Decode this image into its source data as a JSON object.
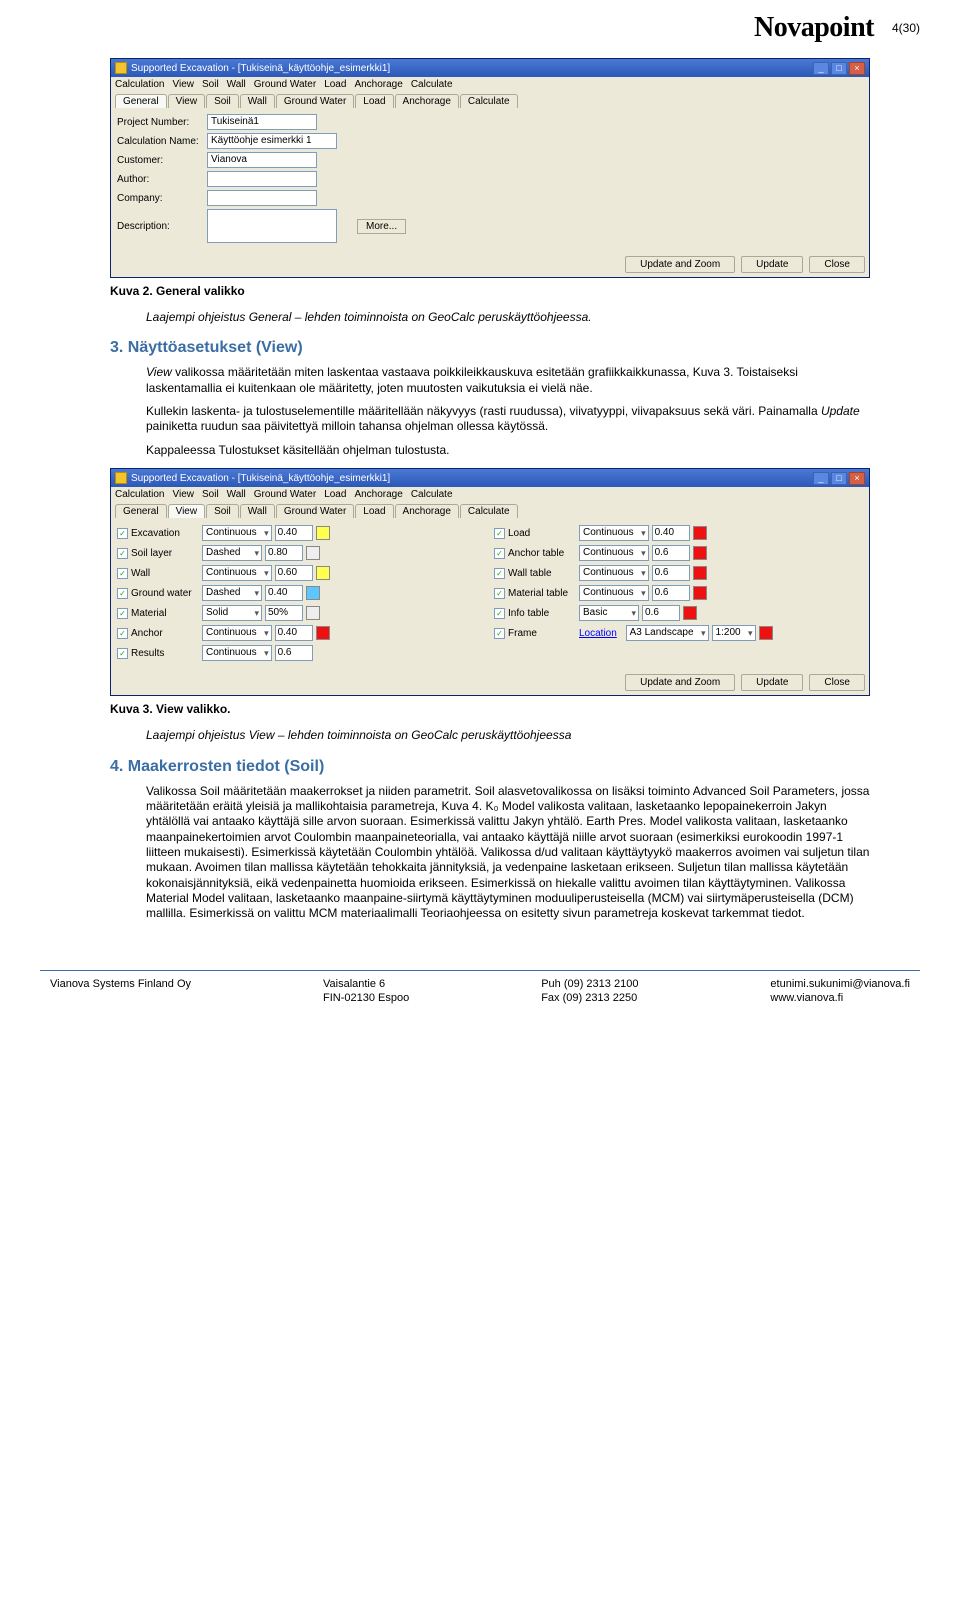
{
  "brand": "Novapoint",
  "page_number": "4(30)",
  "win1": {
    "title": "Supported Excavation - [Tukiseinä_käyttöohje_esimerkki1]",
    "menubar": [
      "Calculation",
      "View",
      "Soil",
      "Wall",
      "Ground Water",
      "Load",
      "Anchorage",
      "Calculate"
    ],
    "tabs": [
      "General",
      "View",
      "Soil",
      "Wall",
      "Ground Water",
      "Load",
      "Anchorage",
      "Calculate"
    ],
    "fields": {
      "project_label": "Project Number:",
      "project_value": "Tukiseinä1",
      "calc_label": "Calculation Name:",
      "calc_value": "Käyttöohje esimerkki 1",
      "customer_label": "Customer:",
      "customer_value": "Vianova",
      "author_label": "Author:",
      "company_label": "Company:",
      "description_label": "Description:",
      "more_btn": "More..."
    },
    "buttons": {
      "uz": "Update and Zoom",
      "u": "Update",
      "c": "Close"
    }
  },
  "caption1": "Kuva 2. General valikko",
  "intro_para": "Laajempi ohjeistus General – lehden toiminnoista on GeoCalc peruskäyttöohjeessa.",
  "section3": {
    "heading": "3. Näyttöasetukset (View)",
    "p1a": "View",
    "p1b": " valikossa määritetään miten laskentaa vastaava poikkileikkauskuva esitetään grafiikkaikkunassa, Kuva 3. Toistaiseksi laskentamallia ei kuitenkaan ole määritetty, joten muutosten vaikutuksia ei vielä näe.",
    "p2a": "Kullekin laskenta- ja tulostuselementille määritellään näkyvyys (rasti ruudussa), viivatyyppi, viivapaksuus sekä väri. Painamalla ",
    "p2b": "Update",
    "p2c": " painiketta ruudun saa päivitettyä milloin tahansa ohjelman ollessa käytössä.",
    "p3": "Kappaleessa Tulostukset käsitellään ohjelman tulostusta."
  },
  "win2": {
    "title": "Supported Excavation - [Tukiseinä_käyttöohje_esimerkki1]",
    "menubar": [
      "Calculation",
      "View",
      "Soil",
      "Wall",
      "Ground Water",
      "Load",
      "Anchorage",
      "Calculate"
    ],
    "tabs": [
      "General",
      "View",
      "Soil",
      "Wall",
      "Ground Water",
      "Load",
      "Anchorage",
      "Calculate"
    ],
    "col1": [
      {
        "name": "Excavation",
        "style": "Continuous",
        "w": "0.40",
        "c": "#ffff4d"
      },
      {
        "name": "Soil layer",
        "style": "Dashed",
        "w": "0.80",
        "c": "#ffffff"
      },
      {
        "name": "Wall",
        "style": "Continuous",
        "w": "0.60",
        "c": "#ffff4d"
      },
      {
        "name": "Ground water",
        "style": "Dashed",
        "w": "0.40",
        "c": "#5cc6ff"
      },
      {
        "name": "Material",
        "style": "Solid",
        "w": "50%",
        "c": "#ffffff"
      },
      {
        "name": "Anchor",
        "style": "Continuous",
        "w": "0.40",
        "c": "#e11"
      },
      {
        "name": "Results",
        "style": "Continuous",
        "w": "0.6",
        "c": ""
      }
    ],
    "col2": [
      {
        "name": "Load",
        "style": "Continuous",
        "w": "0.40",
        "c": "#e11"
      },
      {
        "name": "Anchor table",
        "style": "Continuous",
        "w": "0.6",
        "c": "#e11"
      },
      {
        "name": "Wall table",
        "style": "Continuous",
        "w": "0.6",
        "c": "#e11"
      },
      {
        "name": "Material table",
        "style": "Continuous",
        "w": "0.6",
        "c": "#e11"
      },
      {
        "name": "Info table",
        "style": "Basic",
        "w": "0.6",
        "c": "#e11"
      },
      {
        "name": "Frame",
        "loc_label": "Location",
        "loc": "A3 Landscape",
        "scale": "1:200",
        "c": "#e11"
      }
    ],
    "buttons": {
      "uz": "Update and Zoom",
      "u": "Update",
      "c": "Close"
    }
  },
  "caption2": "Kuva 3. View valikko.",
  "view_outro": "Laajempi ohjeistus View – lehden toiminnoista on GeoCalc peruskäyttöohjeessa",
  "section4": {
    "heading": "4. Maakerrosten tiedot (Soil)",
    "body": "Valikossa Soil määritetään maakerrokset ja niiden parametrit. Soil alasvetovalikossa on lisäksi toiminto Advanced Soil Parameters, jossa määritetään eräitä yleisiä ja mallikohtaisia parametreja, Kuva 4. K₀ Model valikosta valitaan, lasketaanko lepopainekerroin Jakyn yhtälöllä vai antaako käyttäjä sille arvon suoraan. Esimerkissä valittu Jakyn yhtälö. Earth Pres. Model valikosta valitaan, lasketaanko maanpainekertoimien arvot Coulombin maanpaineteorialla, vai antaako käyttäjä niille arvot suoraan (esimerkiksi eurokoodin 1997-1 liitteen mukaisesti). Esimerkissä käytetään Coulombin yhtälöä. Valikossa d/ud valitaan käyttäytyykö maakerros avoimen vai suljetun tilan mukaan. Avoimen tilan mallissa käytetään tehokkaita jännityksiä, ja vedenpaine lasketaan erikseen. Suljetun tilan mallissa käytetään kokonaisjännityksiä, eikä vedenpainetta huomioida erikseen. Esimerkissä on hiekalle valittu avoimen tilan käyttäytyminen. Valikossa Material Model valitaan, lasketaanko maanpaine-siirtymä käyttäytyminen moduuliperusteisella (MCM) vai siirtymäperusteisella (DCM) mallilla. Esimerkissä on valittu MCM materiaalimalli Teoriaohjeessa on esitetty sivun parametreja koskevat tarkemmat tiedot."
  },
  "footer": {
    "company": "Vianova Systems Finland Oy",
    "addr1": "Vaisalantie 6",
    "addr2": "FIN-02130 Espoo",
    "tel1": "Puh  (09) 2313 2100",
    "tel2": "Fax  (09) 2313 2250",
    "email": "etunimi.sukunimi@vianova.fi",
    "web": "www.vianova.fi"
  }
}
